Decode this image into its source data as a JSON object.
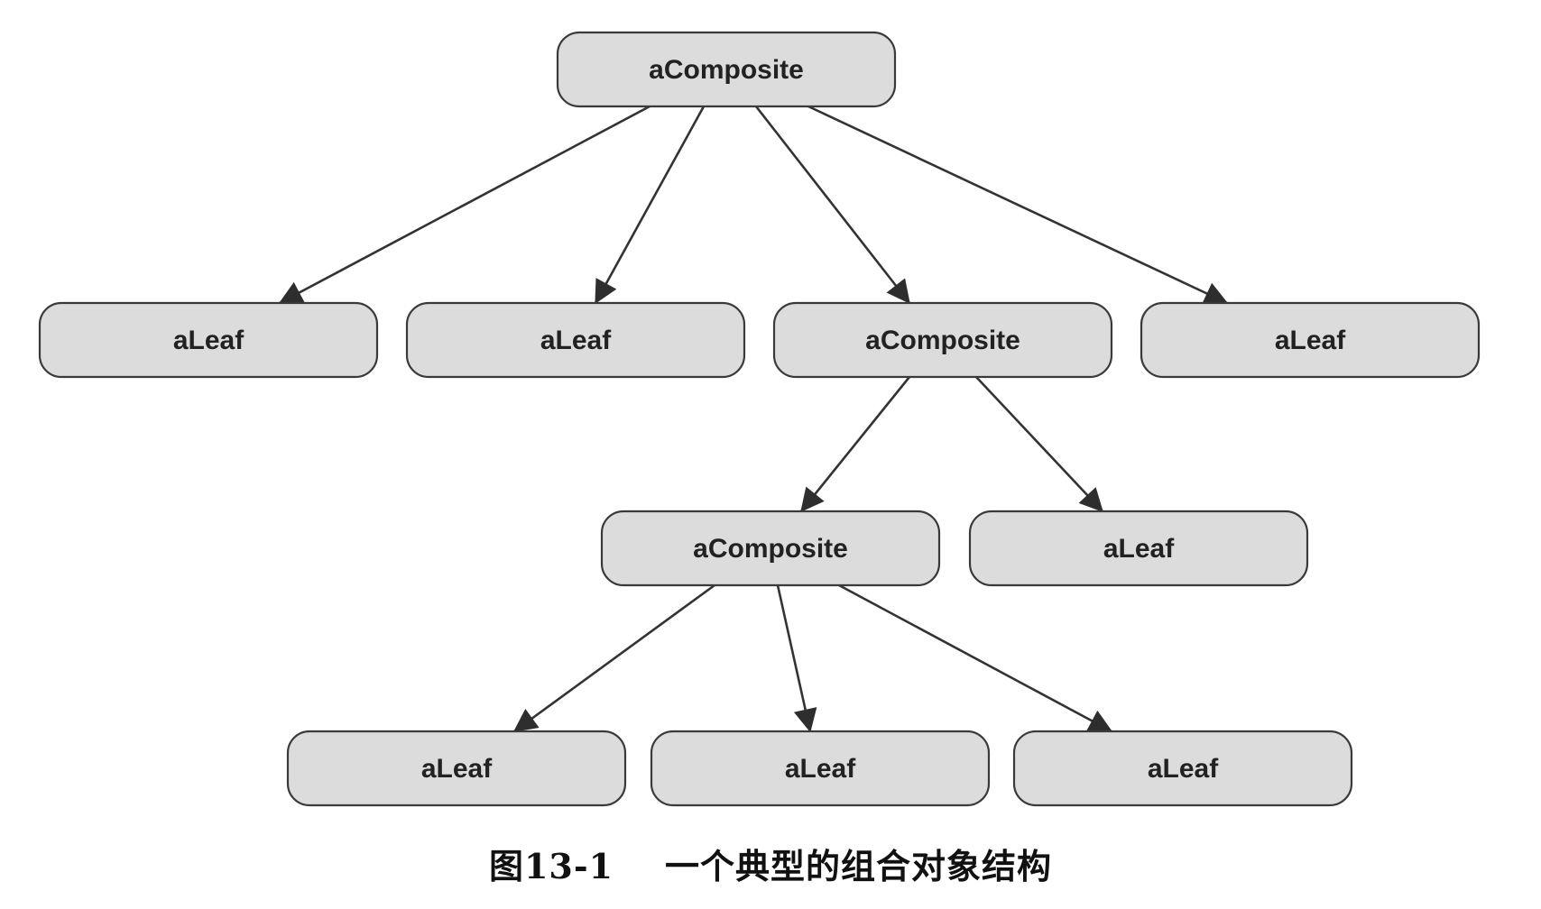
{
  "diagram": {
    "nodes": [
      {
        "id": "root",
        "label": "aComposite"
      },
      {
        "id": "leaf-1",
        "label": "aLeaf"
      },
      {
        "id": "leaf-2",
        "label": "aLeaf"
      },
      {
        "id": "composite-2",
        "label": "aComposite"
      },
      {
        "id": "leaf-3",
        "label": "aLeaf"
      },
      {
        "id": "composite-3",
        "label": "aComposite"
      },
      {
        "id": "leaf-4",
        "label": "aLeaf"
      },
      {
        "id": "leaf-5",
        "label": "aLeaf"
      },
      {
        "id": "leaf-6",
        "label": "aLeaf"
      },
      {
        "id": "leaf-7",
        "label": "aLeaf"
      }
    ],
    "edges": [
      {
        "from": "root",
        "to": "leaf-1"
      },
      {
        "from": "root",
        "to": "leaf-2"
      },
      {
        "from": "root",
        "to": "composite-2"
      },
      {
        "from": "root",
        "to": "leaf-3"
      },
      {
        "from": "composite-2",
        "to": "composite-3"
      },
      {
        "from": "composite-2",
        "to": "leaf-4"
      },
      {
        "from": "composite-3",
        "to": "leaf-5"
      },
      {
        "from": "composite-3",
        "to": "leaf-6"
      },
      {
        "from": "composite-3",
        "to": "leaf-7"
      }
    ]
  },
  "caption": {
    "figure_number": "图13-1",
    "title": "一个典型的组合对象结构"
  }
}
